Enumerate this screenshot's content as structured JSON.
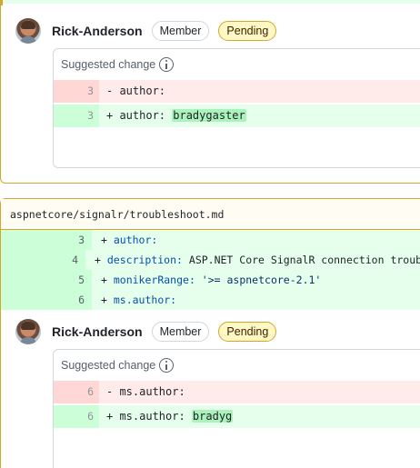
{
  "comment1": {
    "author": "Rick-Anderson",
    "role_badge": "Member",
    "status_badge": "Pending",
    "suggestion_title": "Suggested change",
    "removed": {
      "line": "3",
      "text": "- author:"
    },
    "added": {
      "line": "3",
      "prefix": "+ author: ",
      "highlight": "bradygaster"
    }
  },
  "file": {
    "path": "aspnetcore/signalr/troubleshoot.md",
    "lines": [
      {
        "num": "3",
        "plus": "+ ",
        "key": "author:",
        "val": ""
      },
      {
        "num": "4",
        "plus": "+ ",
        "key": "description:",
        "val": " ASP.NET Core SignalR connection troubl"
      },
      {
        "num": "5",
        "plus": "+ ",
        "key": "monikerRange:",
        "val": " '>= aspnetcore-2.1'"
      },
      {
        "num": "6",
        "plus": "+ ",
        "key": "ms.author:",
        "val": ""
      }
    ]
  },
  "comment2": {
    "author": "Rick-Anderson",
    "role_badge": "Member",
    "status_badge": "Pending",
    "suggestion_title": "Suggested change",
    "removed": {
      "line": "6",
      "text": "- ms.author:"
    },
    "added": {
      "line": "6",
      "prefix": "+ ms.author: ",
      "highlight": "bradyg"
    }
  },
  "icons": [
    "avatar",
    "info-icon"
  ],
  "colors": {
    "pending_border": "#d4a72c",
    "add_bg": "#e6ffec",
    "del_bg": "#ffebe9"
  }
}
